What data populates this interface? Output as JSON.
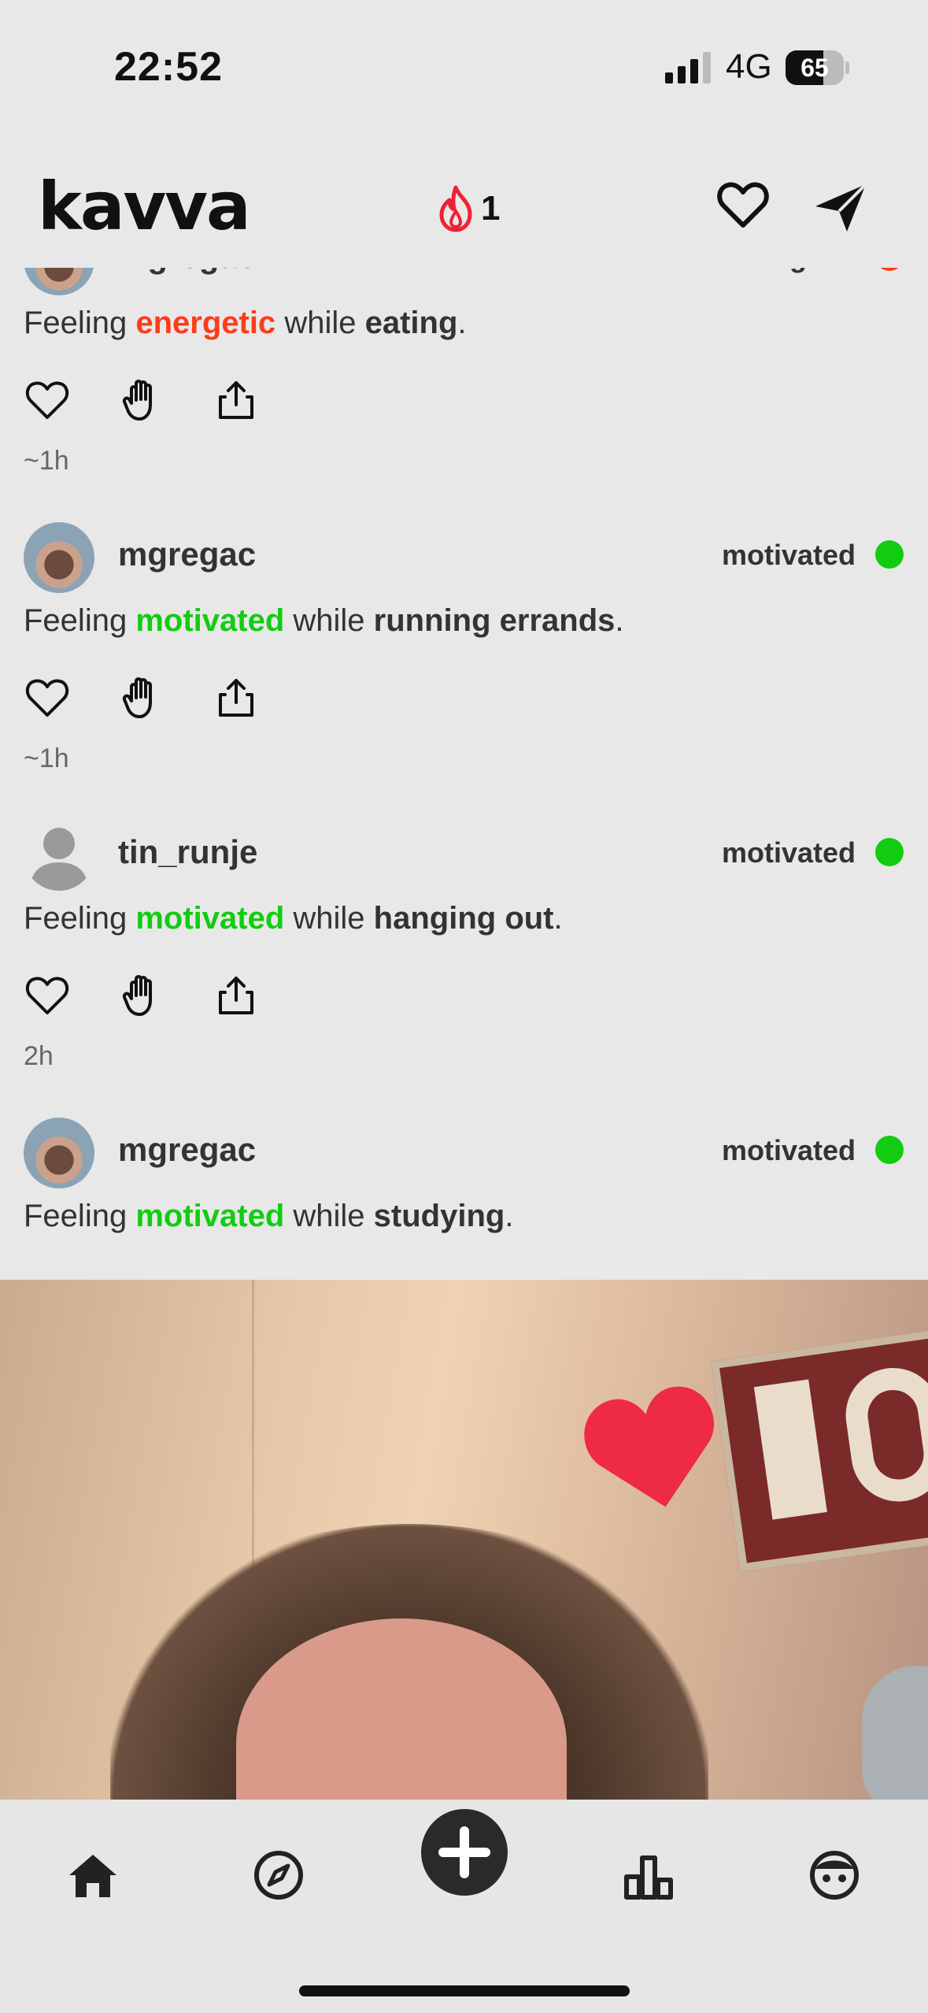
{
  "status_bar": {
    "time": "22:52",
    "network": "4G",
    "battery": "65",
    "battery_level_percent": 65
  },
  "header": {
    "logo": "kavva",
    "streak_count": "1",
    "icons": [
      "flame-icon",
      "heart-icon",
      "send-icon"
    ]
  },
  "colors": {
    "energetic": "#ff3b1a",
    "motivated": "#11cc11",
    "accent_heart": "#ee2a45"
  },
  "feed": {
    "posts": [
      {
        "username": "mgregac",
        "mood": "energetic",
        "feeling_prefix": "Feeling",
        "feeling_mood": "energetic",
        "feeling_mid": "while",
        "activity": "eating",
        "suffix": ".",
        "time": "~1h"
      },
      {
        "username": "mgregac",
        "mood": "motivated",
        "feeling_prefix": "Feeling",
        "feeling_mood": "motivated",
        "feeling_mid": "while",
        "activity": "running errands",
        "suffix": ".",
        "time": "~1h"
      },
      {
        "username": "tin_runje",
        "mood": "motivated",
        "feeling_prefix": "Feeling",
        "feeling_mood": "motivated",
        "feeling_mid": "while",
        "activity": "hanging out",
        "suffix": ".",
        "time": "2h"
      },
      {
        "username": "mgregac",
        "mood": "motivated",
        "feeling_prefix": "Feeling",
        "feeling_mood": "motivated",
        "feeling_mid": "while",
        "activity": "studying",
        "suffix": "."
      }
    ]
  },
  "tab_bar": {
    "icons": [
      "home-icon",
      "compass-icon",
      "plus-icon",
      "stats-icon",
      "profile-icon"
    ]
  }
}
